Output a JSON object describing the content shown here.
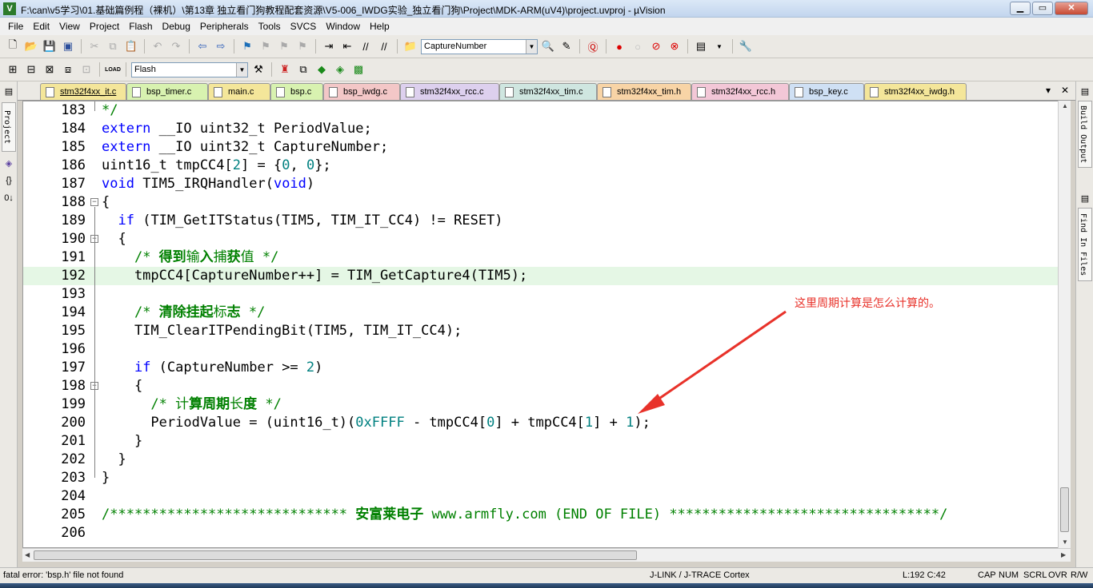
{
  "window": {
    "title": "F:\\can\\v5学习\\01.基础篇例程（裸机）\\第13章 独立看门狗教程配套资源\\V5-006_IWDG实验_独立看门狗\\Project\\MDK-ARM(uV4)\\project.uvproj - µVision",
    "minimize": "▁",
    "maximize": "▭",
    "close": "✕"
  },
  "menu": [
    "File",
    "Edit",
    "View",
    "Project",
    "Flash",
    "Debug",
    "Peripherals",
    "Tools",
    "SVCS",
    "Window",
    "Help"
  ],
  "toolbar": {
    "find_combo_value": "CaptureNumber",
    "target_combo_value": "Flash",
    "load_label": "LOAD"
  },
  "side_tabs": {
    "left": "Project",
    "right_top": "Build Output",
    "right_bottom": "Find In Files",
    "functions_icon": "{}",
    "templates_icon": "0↓"
  },
  "tabs": [
    {
      "label": "stm32f4xx_it.c",
      "color": "#f4e69a",
      "active": true
    },
    {
      "label": "bsp_timer.c",
      "color": "#d8f2b0"
    },
    {
      "label": "main.c",
      "color": "#f4e69a"
    },
    {
      "label": "bsp.c",
      "color": "#d8f2b0"
    },
    {
      "label": "bsp_iwdg.c",
      "color": "#f3c7c7"
    },
    {
      "label": "stm32f4xx_rcc.c",
      "color": "#ddd0ee"
    },
    {
      "label": "stm32f4xx_tim.c",
      "color": "#cfe6e0"
    },
    {
      "label": "stm32f4xx_tim.h",
      "color": "#f8d4a6"
    },
    {
      "label": "stm32f4xx_rcc.h",
      "color": "#f3c7d7"
    },
    {
      "label": "bsp_key.c",
      "color": "#cfe0f4"
    },
    {
      "label": "stm32f4xx_iwdg.h",
      "color": "#f4e69a"
    }
  ],
  "tab_controls": {
    "dropdown": "▾",
    "close": "✕"
  },
  "code": {
    "highlighted_line": "192",
    "lines": [
      {
        "n": "183",
        "fold": "",
        "segs": [
          [
            "cm",
            "*/"
          ]
        ]
      },
      {
        "n": "184",
        "fold": "",
        "segs": [
          [
            "kw",
            "extern"
          ],
          [
            "",
            " __IO uint32_t PeriodValue;"
          ]
        ]
      },
      {
        "n": "185",
        "fold": "",
        "segs": [
          [
            "kw",
            "extern"
          ],
          [
            "",
            " __IO uint32_t CaptureNumber;"
          ]
        ]
      },
      {
        "n": "186",
        "fold": "",
        "segs": [
          [
            "",
            "uint16_t tmpCC4["
          ],
          [
            "nm",
            "2"
          ],
          [
            "",
            "] = {"
          ],
          [
            "nm",
            "0"
          ],
          [
            "",
            ", "
          ],
          [
            "nm",
            "0"
          ],
          [
            "",
            "};"
          ]
        ]
      },
      {
        "n": "187",
        "fold": "",
        "segs": [
          [
            "kw",
            "void"
          ],
          [
            "",
            " TIM5_IRQHandler("
          ],
          [
            "kw",
            "void"
          ],
          [
            "",
            ")"
          ]
        ]
      },
      {
        "n": "188",
        "fold": "box",
        "segs": [
          [
            "",
            "{"
          ]
        ]
      },
      {
        "n": "189",
        "fold": "",
        "segs": [
          [
            "",
            "  "
          ],
          [
            "kw",
            "if"
          ],
          [
            "",
            " (TIM_GetITStatus(TIM5, TIM_IT_CC4) != RESET)"
          ]
        ]
      },
      {
        "n": "190",
        "fold": "box",
        "segs": [
          [
            "",
            "  {"
          ]
        ]
      },
      {
        "n": "191",
        "fold": "",
        "segs": [
          [
            "",
            "    "
          ],
          [
            "cm",
            "/* "
          ],
          [
            "cmz",
            "得到"
          ],
          [
            "cm",
            "输"
          ],
          [
            "cmz",
            "入"
          ],
          [
            "cm",
            "捕"
          ],
          [
            "cmz",
            "获"
          ],
          [
            "cm",
            "值 */"
          ]
        ]
      },
      {
        "n": "192",
        "fold": "",
        "segs": [
          [
            "",
            "    tmpCC4[CaptureNumber++] = TIM_GetCapt"
          ],
          [
            "",
            "ure4(TIM5);"
          ]
        ]
      },
      {
        "n": "193",
        "fold": "",
        "segs": [
          [
            "",
            ""
          ]
        ]
      },
      {
        "n": "194",
        "fold": "",
        "segs": [
          [
            "",
            "    "
          ],
          [
            "cm",
            "/* "
          ],
          [
            "cmz",
            "清除挂起"
          ],
          [
            "cm",
            "标"
          ],
          [
            "cmz",
            "志"
          ],
          [
            "cm",
            " */"
          ]
        ]
      },
      {
        "n": "195",
        "fold": "",
        "segs": [
          [
            "",
            "    TIM_ClearITPendingBit(TIM5, TIM_IT_CC4);"
          ]
        ]
      },
      {
        "n": "196",
        "fold": "",
        "segs": [
          [
            "",
            ""
          ]
        ]
      },
      {
        "n": "197",
        "fold": "",
        "segs": [
          [
            "",
            "    "
          ],
          [
            "kw",
            "if"
          ],
          [
            "",
            " (CaptureNumber >= "
          ],
          [
            "nm",
            "2"
          ],
          [
            "",
            ")"
          ]
        ]
      },
      {
        "n": "198",
        "fold": "box",
        "segs": [
          [
            "",
            "    {"
          ]
        ]
      },
      {
        "n": "199",
        "fold": "",
        "segs": [
          [
            "",
            "      "
          ],
          [
            "cm",
            "/* "
          ],
          [
            "cm",
            "计"
          ],
          [
            "cmz",
            "算周期"
          ],
          [
            "cm",
            "长"
          ],
          [
            "cmz",
            "度"
          ],
          [
            "cm",
            " */"
          ]
        ]
      },
      {
        "n": "200",
        "fold": "",
        "segs": [
          [
            "",
            "      PeriodValue = (uint16_t)("
          ],
          [
            "nm",
            "0xFFFF"
          ],
          [
            "",
            " - tmpCC4["
          ],
          [
            "nm",
            "0"
          ],
          [
            "",
            "] + tmpCC4["
          ],
          [
            "nm",
            "1"
          ],
          [
            "",
            "] + "
          ],
          [
            "nm",
            "1"
          ],
          [
            "",
            ");"
          ]
        ]
      },
      {
        "n": "201",
        "fold": "",
        "segs": [
          [
            "",
            "    }"
          ]
        ]
      },
      {
        "n": "202",
        "fold": "",
        "segs": [
          [
            "",
            "  }"
          ]
        ]
      },
      {
        "n": "203",
        "fold": "",
        "segs": [
          [
            "",
            "}"
          ]
        ]
      },
      {
        "n": "204",
        "fold": "",
        "segs": [
          [
            "",
            ""
          ]
        ]
      },
      {
        "n": "205",
        "fold": "",
        "segs": [
          [
            "cm",
            "/***************************** "
          ],
          [
            "cmz",
            "安富莱电子"
          ],
          [
            "cm",
            " www.armfly.com (END OF FILE) *********************************/"
          ]
        ]
      },
      {
        "n": "206",
        "fold": "",
        "segs": [
          [
            "",
            ""
          ]
        ]
      }
    ]
  },
  "annotation": {
    "text": "这里周期计算是怎么计算的。",
    "color": "#e8322a"
  },
  "status": {
    "message": "fatal error: 'bsp.h' file not found",
    "debugger": "J-LINK / J-TRACE Cortex",
    "position": "L:192 C:42",
    "cap": "CAP",
    "num": "NUM",
    "scrl": "SCRL",
    "ovr": "OVR",
    "rw": "R/W"
  },
  "colors": {
    "keyword": "#0000ff",
    "comment": "#008000",
    "number": "#008080",
    "current_line": "#e5f7e5"
  }
}
